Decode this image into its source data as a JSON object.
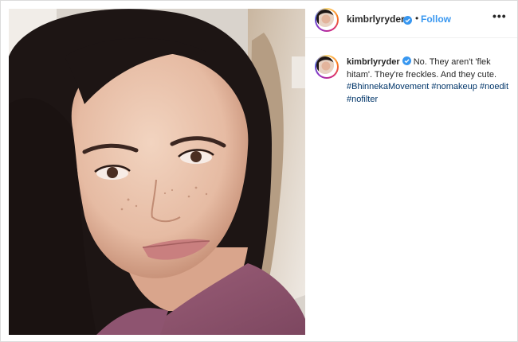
{
  "post": {
    "username": "kimbrlyryder",
    "follow_label": "Follow",
    "separator": "•",
    "more_label": "•••"
  },
  "caption": {
    "username": "kimbrlyryder",
    "text": " No. They aren't 'flek hitam'. They're freckles. And they cute. ",
    "hashtags": [
      "#BhinnekaMovement",
      "#nomakeup",
      "#noedit",
      "#nofilter"
    ]
  },
  "colors": {
    "follow_blue": "#3897f0",
    "hashtag_blue": "#003569",
    "verified_blue": "#3897f0"
  },
  "icons": {
    "verified": "verified-badge-icon",
    "more": "more-options-icon"
  }
}
